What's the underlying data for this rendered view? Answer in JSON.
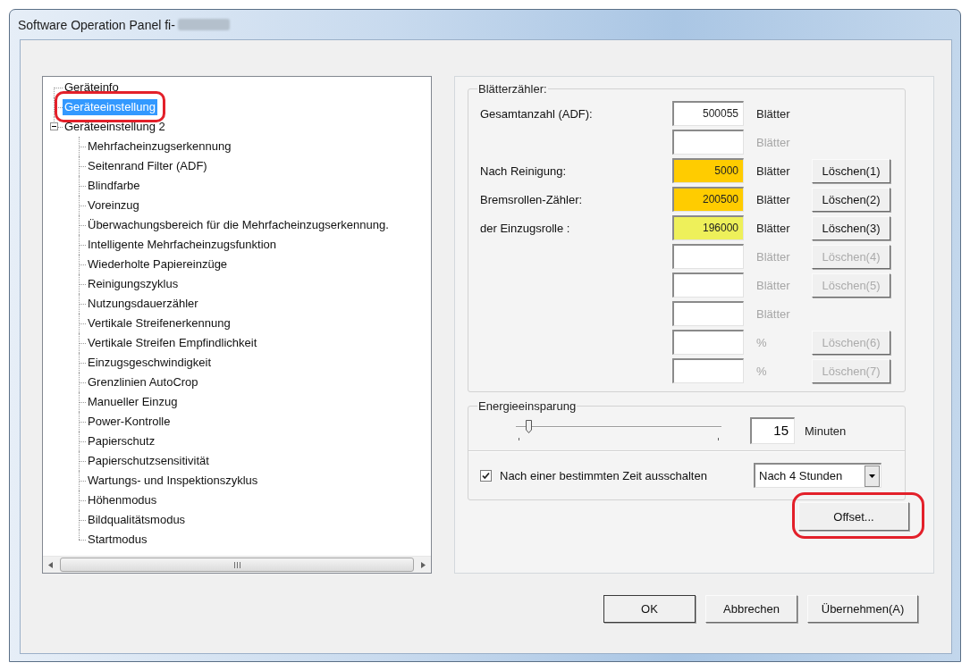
{
  "window": {
    "title": "Software Operation Panel fi-"
  },
  "tree": {
    "items": [
      {
        "label": "Geräteinfo",
        "selected": false,
        "circled": false
      },
      {
        "label": "Geräteeinstellung",
        "selected": true,
        "circled": true
      },
      {
        "label": "Geräteeinstellung 2",
        "selected": false,
        "circled": false,
        "expanded": true,
        "children": [
          {
            "label": "Mehrfacheinzugserkennung",
            "selected": false,
            "circled": false
          },
          {
            "label": "Seitenrand Filter (ADF)",
            "selected": false,
            "circled": false
          },
          {
            "label": "Blindfarbe",
            "selected": false,
            "circled": false
          },
          {
            "label": "Voreinzug",
            "selected": false,
            "circled": false
          },
          {
            "label": "Überwachungsbereich für die Mehrfacheinzugserkennung.",
            "selected": false,
            "circled": false
          },
          {
            "label": "Intelligente Mehrfacheinzugsfunktion",
            "selected": false,
            "circled": false
          },
          {
            "label": "Wiederholte Papiereinzüge",
            "selected": false,
            "circled": false
          },
          {
            "label": "Reinigungszyklus",
            "selected": false,
            "circled": false
          },
          {
            "label": "Nutzungsdauerzähler",
            "selected": false,
            "circled": false
          },
          {
            "label": "Vertikale Streifenerkennung",
            "selected": false,
            "circled": false
          },
          {
            "label": "Vertikale Streifen Empfindlichkeit",
            "selected": false,
            "circled": false
          },
          {
            "label": "Einzugsgeschwindigkeit",
            "selected": false,
            "circled": false
          },
          {
            "label": "Grenzlinien AutoCrop",
            "selected": false,
            "circled": false
          },
          {
            "label": "Manueller Einzug",
            "selected": false,
            "circled": false
          },
          {
            "label": "Power-Kontrolle",
            "selected": false,
            "circled": false
          },
          {
            "label": "Papierschutz",
            "selected": false,
            "circled": false
          },
          {
            "label": "Papierschutzsensitivität",
            "selected": false,
            "circled": false
          },
          {
            "label": "Wartungs- und Inspektionszyklus",
            "selected": false,
            "circled": false
          },
          {
            "label": "Höhenmodus",
            "selected": false,
            "circled": false
          },
          {
            "label": "Bildqualitätsmodus",
            "selected": false,
            "circled": false
          },
          {
            "label": "Startmodus",
            "selected": false,
            "circled": false
          }
        ]
      }
    ]
  },
  "sheet_counter": {
    "title": "Blätterzähler:",
    "rows": [
      {
        "label": "Gesamtanzahl (ADF):",
        "value": "500055",
        "unit": "Blätter",
        "disabled": false
      },
      {
        "unit": "Blätter",
        "disabled": true
      },
      {
        "label": "Nach Reinigung:",
        "value": "5000",
        "unit": "Blätter",
        "button": "Löschen(1)",
        "disabled": false,
        "color": "#ffcc00"
      },
      {
        "label": "Bremsrollen-Zähler:",
        "value": "200500",
        "unit": "Blätter",
        "button": "Löschen(2)",
        "disabled": false,
        "color": "#ffcc00"
      },
      {
        "label": "der Einzugsrolle :",
        "value": "196000",
        "unit": "Blätter",
        "button": "Löschen(3)",
        "disabled": false,
        "color": "#eef05a"
      },
      {
        "unit": "Blätter",
        "button": "Löschen(4)",
        "disabled": true
      },
      {
        "unit": "Blätter",
        "button": "Löschen(5)",
        "disabled": true
      },
      {
        "unit": "Blätter",
        "disabled": true
      },
      {
        "unit": "%",
        "button": "Löschen(6)",
        "disabled": true
      },
      {
        "unit": "%",
        "button": "Löschen(7)",
        "disabled": true
      }
    ]
  },
  "power_saving": {
    "title": "Energieeinsparung",
    "slider": {
      "level": 0.06
    },
    "minutes": "15",
    "unit": "Minuten",
    "auto_off": {
      "label": "Nach einer bestimmten Zeit ausschalten",
      "checked": true
    },
    "auto_off_time": "Nach 4 Stunden"
  },
  "offset_button": {
    "label": "Offset...",
    "circled": true
  },
  "buttons": [
    {
      "label": "OK",
      "default": true
    },
    {
      "label": "Abbrechen",
      "default": false
    },
    {
      "label": "Übernehmen(A)",
      "default": false
    }
  ]
}
